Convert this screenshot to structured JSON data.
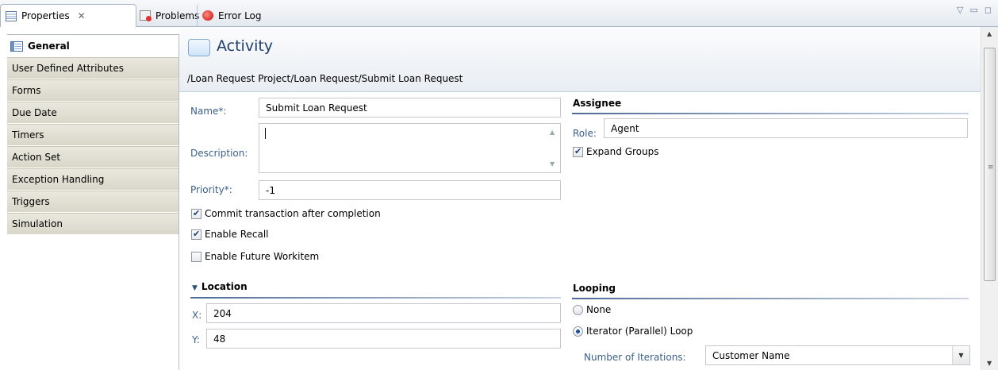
{
  "tabs": [
    {
      "label": "Properties",
      "icon": "properties-icon",
      "active": true
    },
    {
      "label": "Problems",
      "icon": "problems-icon"
    },
    {
      "label": "Error Log",
      "icon": "error-log-icon"
    }
  ],
  "sidebar": {
    "items": [
      {
        "label": "General",
        "selected": true
      },
      {
        "label": "User Defined Attributes"
      },
      {
        "label": "Forms"
      },
      {
        "label": "Due Date"
      },
      {
        "label": "Timers"
      },
      {
        "label": "Action Set"
      },
      {
        "label": "Exception Handling"
      },
      {
        "label": "Triggers"
      },
      {
        "label": "Simulation"
      }
    ]
  },
  "header": {
    "title": "Activity",
    "path": "/Loan Request Project/Loan Request/Submit Loan Request"
  },
  "general": {
    "name_label": "Name*:",
    "name_value": "Submit Loan Request",
    "description_label": "Description:",
    "description_value": "",
    "priority_label": "Priority*:",
    "priority_value": "-1",
    "commit_label": "Commit transaction after completion",
    "commit_checked": true,
    "recall_label": "Enable Recall",
    "recall_checked": true,
    "future_label": "Enable Future Workitem",
    "future_checked": false
  },
  "assignee": {
    "title": "Assignee",
    "role_label": "Role:",
    "role_value": "Agent",
    "expand_label": "Expand Groups",
    "expand_checked": true
  },
  "location": {
    "title": "Location",
    "x_label": "X:",
    "x_value": "204",
    "y_label": "Y:",
    "y_value": "48"
  },
  "looping": {
    "title": "Looping",
    "none_label": "None",
    "iterator_label": "Iterator (Parallel) Loop",
    "selected": "Iterator (Parallel) Loop",
    "iterations_label": "Number of Iterations:",
    "iterations_value": "Customer Name"
  },
  "colors": {
    "label_blue": "#3b5f8a",
    "title_blue": "#1f3d6b",
    "sidebar_bg": "#d9d7c9"
  }
}
